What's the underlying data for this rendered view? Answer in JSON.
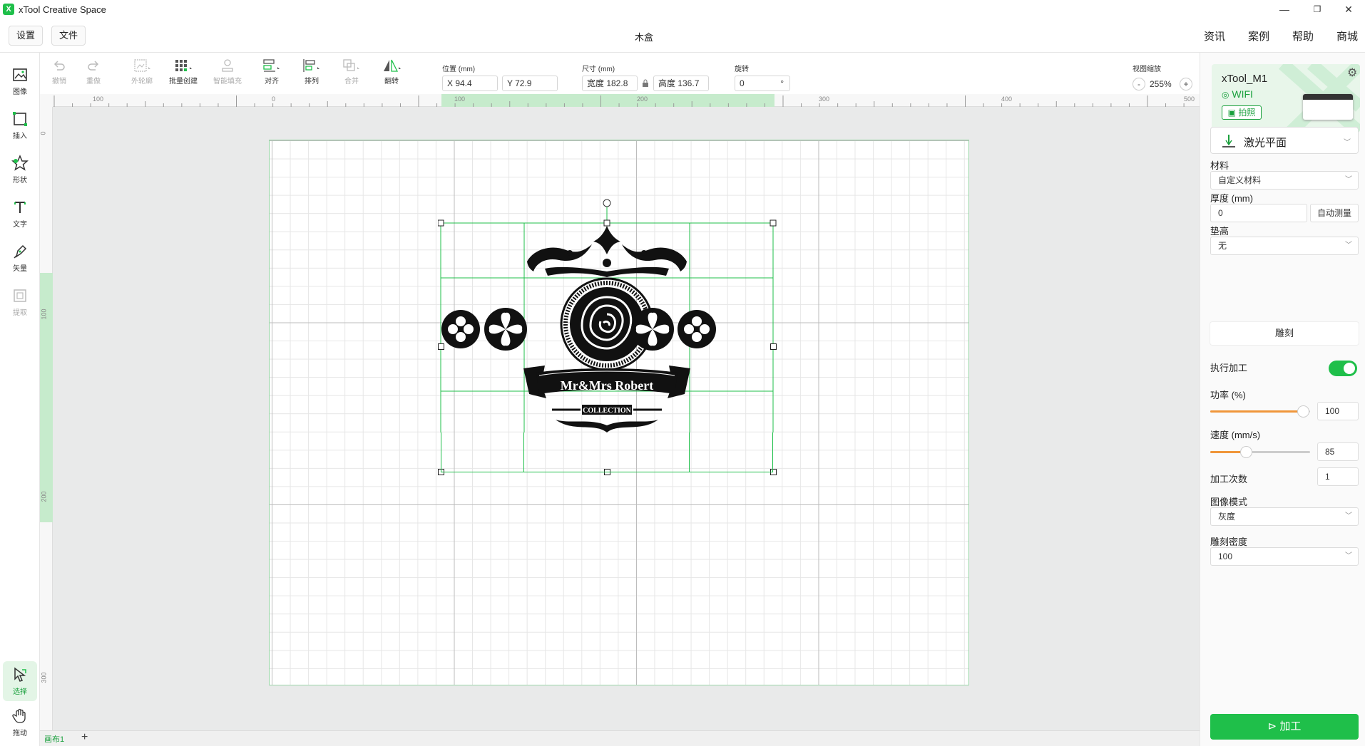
{
  "window": {
    "title": "xTool Creative Space",
    "logo_glyph": "X",
    "minimize": "—",
    "restore": "❐",
    "close": "✕"
  },
  "menubar": {
    "settings": "设置",
    "file": "文件",
    "doc_title": "木盒",
    "links": [
      "资讯",
      "案例",
      "帮助",
      "商城"
    ]
  },
  "left_tools": [
    {
      "label": "图像",
      "icon": "image-icon",
      "enabled": true
    },
    {
      "label": "插入",
      "icon": "insert-icon",
      "enabled": true
    },
    {
      "label": "形状",
      "icon": "shape-icon",
      "enabled": true
    },
    {
      "label": "文字",
      "icon": "text-icon",
      "enabled": true
    },
    {
      "label": "矢量",
      "icon": "pen-icon",
      "enabled": true
    },
    {
      "label": "提取",
      "icon": "extract-icon",
      "enabled": false
    },
    {
      "label": "选择",
      "icon": "cursor-icon",
      "enabled": true,
      "active": true
    },
    {
      "label": "拖动",
      "icon": "hand-icon",
      "enabled": true
    }
  ],
  "toolbar": {
    "undo": "撤销",
    "redo": "重做",
    "outline": "外轮廓",
    "batch": "批量创建",
    "smart_fill": "智能填充",
    "align": "对齐",
    "arrange": "排列",
    "combine": "合并",
    "flip": "翻转",
    "position_label": "位置 (mm)",
    "x_value": "X 94.4",
    "y_value": "Y 72.9",
    "size_label": "尺寸 (mm)",
    "width_value": "宽度 182.8",
    "height_value": "高度 136.7",
    "rotate_label": "旋转",
    "rotate_value": "0",
    "rotate_unit": "°",
    "zoom_label": "视图缩放",
    "zoom_value": "255%",
    "zoom_minus": "-",
    "zoom_plus": "+"
  },
  "ruler": {
    "top_ticks": [
      "100",
      "0",
      "100",
      "200",
      "300",
      "400",
      "500"
    ],
    "left_ticks": [
      "0",
      "100",
      "200",
      "300"
    ]
  },
  "artwork": {
    "banner_text": "Mr&Mrs Robert",
    "sub_text": "COLLECTION"
  },
  "bottom_tabs": {
    "canvas1": "画布1",
    "add": "+"
  },
  "right_panel": {
    "device_name": "xTool_M1",
    "device_connection": "WIFI",
    "photo_button": "拍照",
    "laser_plane": "激光平面",
    "material_label": "材料",
    "material_value": "自定义材料",
    "thickness_label": "厚度 (mm)",
    "thickness_value": "0",
    "auto_measure": "自动测量",
    "riser_label": "垫高",
    "riser_value": "无",
    "engrave_tab": "雕刻",
    "execute_label": "执行加工",
    "execute_on": true,
    "power_label": "功率 (%)",
    "power_value": "100",
    "power_fraction": 1.0,
    "speed_label": "速度 (mm/s)",
    "speed_value": "85",
    "passes_label": "加工次数",
    "passes_value": "1",
    "image_mode_label": "图像模式",
    "image_mode_value": "灰度",
    "density_label": "雕刻密度",
    "density_value": "100",
    "process_button": "加工"
  },
  "colors": {
    "accent": "#1fbf4a",
    "slider": "#f0963a",
    "selection": "#1fbf4a"
  }
}
